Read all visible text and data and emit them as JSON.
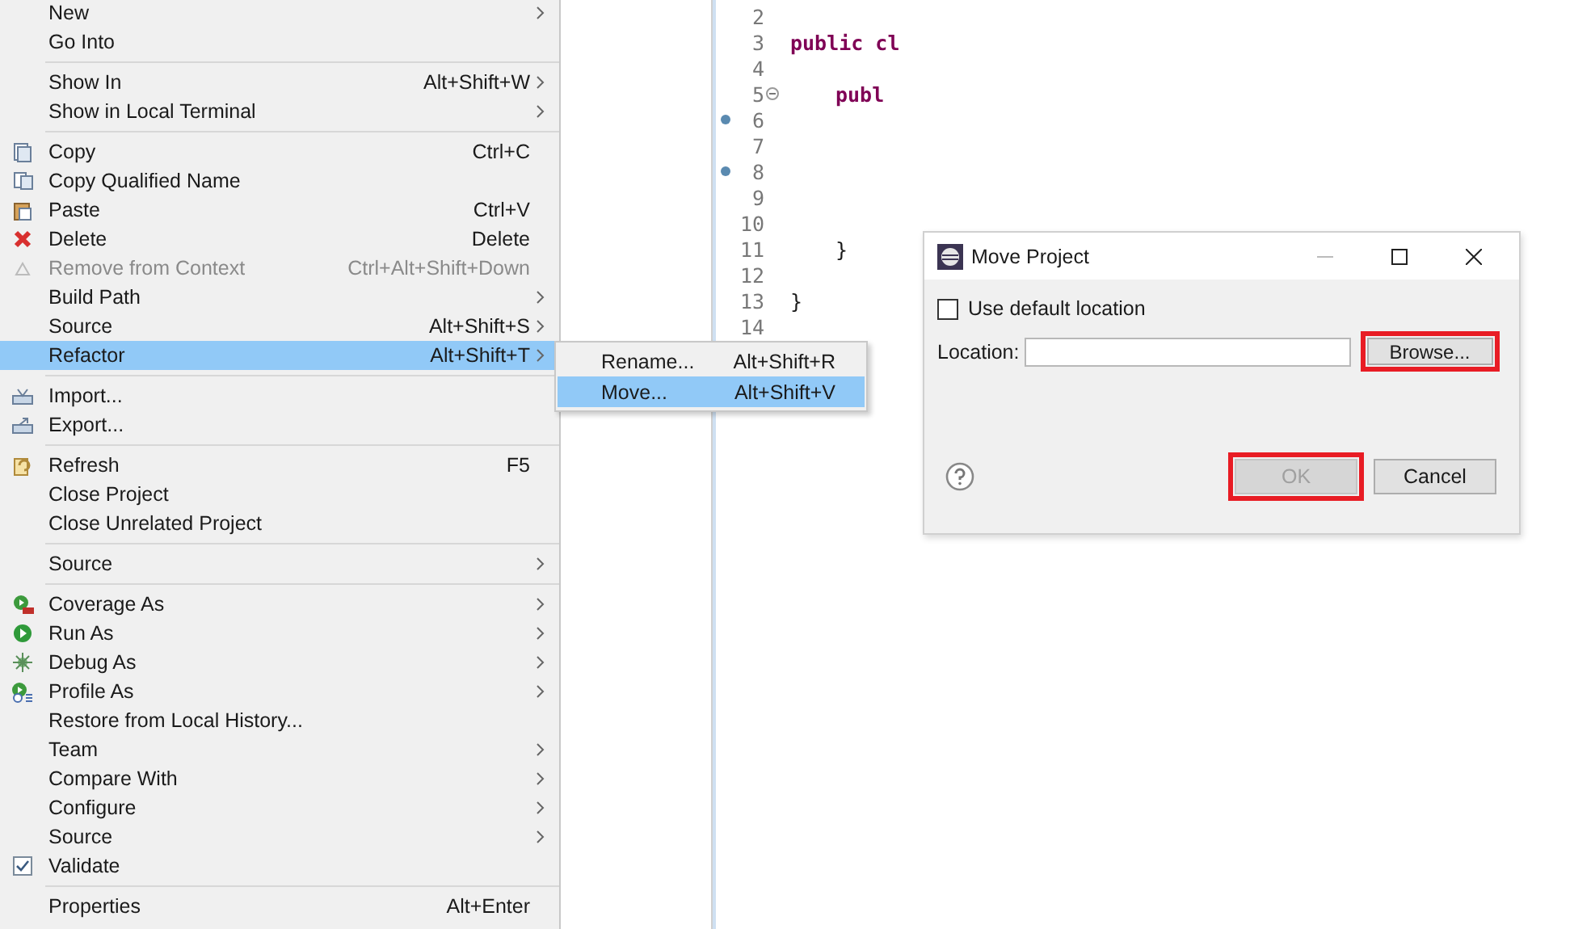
{
  "context_menu": {
    "groups": [
      [
        {
          "label": "New",
          "submenu": true
        },
        {
          "label": "Go Into"
        }
      ],
      [
        {
          "label": "Show In",
          "shortcut": "Alt+Shift+W",
          "submenu": true
        },
        {
          "label": "Show in Local Terminal",
          "submenu": true
        }
      ],
      [
        {
          "label": "Copy",
          "shortcut": "Ctrl+C",
          "kind": "copy"
        },
        {
          "label": "Copy Qualified Name",
          "kind": "copy-qualified"
        },
        {
          "label": "Paste",
          "shortcut": "Ctrl+V",
          "kind": "paste"
        },
        {
          "label": "Delete",
          "shortcut": "Delete",
          "kind": "delete"
        },
        {
          "label": "Remove from Context",
          "shortcut": "Ctrl+Alt+Shift+Down",
          "kind": "remove",
          "disabled": true
        },
        {
          "label": "Build Path",
          "submenu": true
        },
        {
          "label": "Source",
          "shortcut": "Alt+Shift+S",
          "submenu": true
        },
        {
          "label": "Refactor",
          "shortcut": "Alt+Shift+T",
          "submenu": true,
          "selected": true
        }
      ],
      [
        {
          "label": "Import...",
          "kind": "import"
        },
        {
          "label": "Export...",
          "kind": "export"
        }
      ],
      [
        {
          "label": "Refresh",
          "shortcut": "F5",
          "kind": "refresh"
        },
        {
          "label": "Close Project"
        },
        {
          "label": "Close Unrelated Project"
        }
      ],
      [
        {
          "label": "Source",
          "submenu": true
        }
      ],
      [
        {
          "label": "Coverage As",
          "kind": "coverage",
          "submenu": true
        },
        {
          "label": "Run As",
          "kind": "run",
          "submenu": true
        },
        {
          "label": "Debug As",
          "kind": "debug",
          "submenu": true
        },
        {
          "label": "Profile As",
          "kind": "profile",
          "submenu": true
        },
        {
          "label": "Restore from Local History..."
        },
        {
          "label": "Team",
          "submenu": true
        },
        {
          "label": "Compare With",
          "submenu": true
        },
        {
          "label": "Configure",
          "submenu": true
        },
        {
          "label": "Source",
          "submenu": true
        },
        {
          "label": "Validate",
          "kind": "check"
        }
      ],
      [
        {
          "label": "Properties",
          "shortcut": "Alt+Enter"
        }
      ]
    ]
  },
  "submenu": {
    "items": [
      {
        "label": "Rename...",
        "shortcut": "Alt+Shift+R",
        "selected": false
      },
      {
        "label": "Move...",
        "shortcut": "Alt+Shift+V",
        "selected": true
      }
    ]
  },
  "editor": {
    "lines": [
      {
        "number": "2"
      },
      {
        "number": "3",
        "code": "public cl",
        "keyword": true
      },
      {
        "number": "4"
      },
      {
        "number": "5",
        "code": "publ",
        "keyword": true,
        "indented": true,
        "kind": "fold"
      },
      {
        "number": "6",
        "kind": "dot"
      },
      {
        "number": "7"
      },
      {
        "number": "8",
        "kind": "dot"
      },
      {
        "number": "9"
      },
      {
        "number": "10"
      },
      {
        "number": "11",
        "code": "}",
        "indented": true
      },
      {
        "number": "12"
      },
      {
        "number": "13",
        "code": "}"
      },
      {
        "number": "14"
      }
    ]
  },
  "dialog": {
    "title": "Move Project",
    "use_default_location": {
      "label": "Use default location",
      "checked": false
    },
    "location_label": "Location:",
    "browse": {
      "label": "Browse...",
      "highlighted": true
    },
    "ok": {
      "label": "OK",
      "disabled": true,
      "highlighted": true
    },
    "cancel": {
      "label": "Cancel",
      "highlighted": false
    }
  }
}
